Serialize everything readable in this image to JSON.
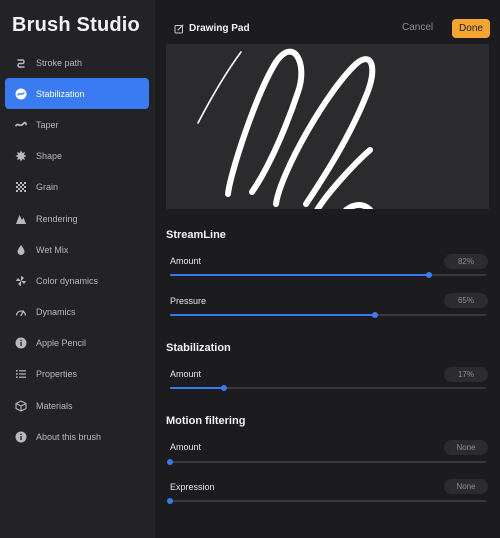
{
  "app": {
    "title": "Brush Studio"
  },
  "sidebar": {
    "items": [
      {
        "label": "Stroke path",
        "icon": "stroke-path-icon",
        "active": false
      },
      {
        "label": "Stabilization",
        "icon": "stabilization-icon",
        "active": true
      },
      {
        "label": "Taper",
        "icon": "taper-icon",
        "active": false
      },
      {
        "label": "Shape",
        "icon": "shape-icon",
        "active": false
      },
      {
        "label": "Grain",
        "icon": "grain-icon",
        "active": false
      },
      {
        "label": "Rendering",
        "icon": "rendering-icon",
        "active": false
      },
      {
        "label": "Wet Mix",
        "icon": "wet-mix-icon",
        "active": false
      },
      {
        "label": "Color dynamics",
        "icon": "color-dynamics-icon",
        "active": false
      },
      {
        "label": "Dynamics",
        "icon": "dynamics-icon",
        "active": false
      },
      {
        "label": "Apple Pencil",
        "icon": "apple-pencil-icon",
        "active": false
      },
      {
        "label": "Properties",
        "icon": "properties-icon",
        "active": false
      },
      {
        "label": "Materials",
        "icon": "materials-icon",
        "active": false
      },
      {
        "label": "About this brush",
        "icon": "about-icon",
        "active": false
      }
    ]
  },
  "header": {
    "title": "Drawing Pad",
    "cancel_label": "Cancel",
    "done_label": "Done"
  },
  "colors": {
    "accent": "#3a7bf2",
    "done": "#f4a532",
    "background": "#1c1c1e",
    "sidebar": "#232325"
  },
  "sections": [
    {
      "title": "StreamLine",
      "rows": [
        {
          "label": "Amount",
          "value": "82%",
          "level": 0.82
        },
        {
          "label": "Pressure",
          "value": "65%",
          "level": 0.65
        }
      ]
    },
    {
      "title": "Stabilization",
      "rows": [
        {
          "label": "Amount",
          "value": "17%",
          "level": 0.17
        }
      ]
    },
    {
      "title": "Motion filtering",
      "rows": [
        {
          "label": "Amount",
          "value": "None",
          "level": 0
        },
        {
          "label": "Expression",
          "value": "None",
          "level": 0
        }
      ]
    }
  ]
}
